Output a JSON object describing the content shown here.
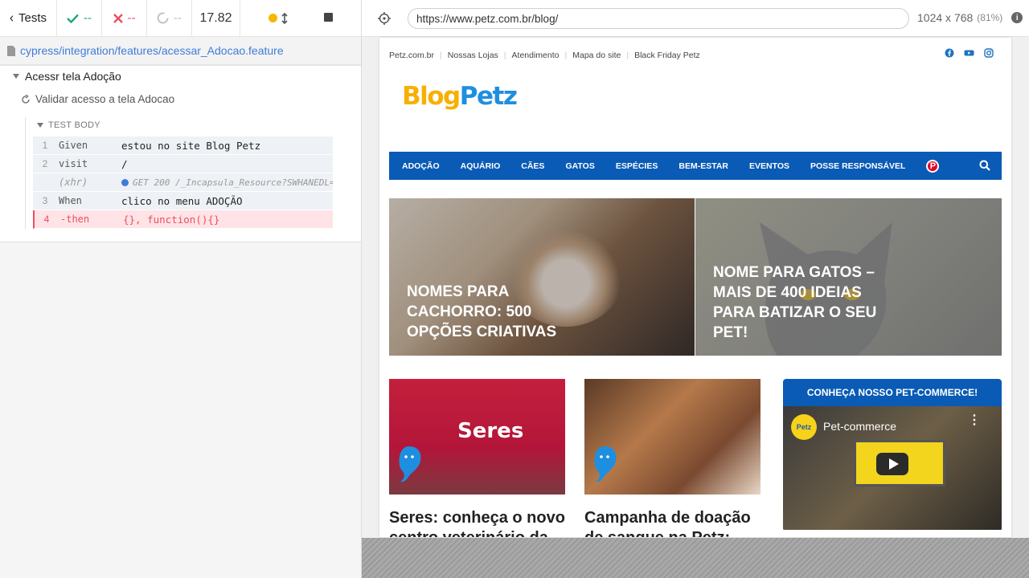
{
  "reporter": {
    "back_label": "Tests",
    "passed": "--",
    "failed": "--",
    "pending": "--",
    "duration": "17.82"
  },
  "spec": {
    "path": "cypress/integration/features/acessar_Adocao.feature"
  },
  "suite": {
    "title": "Acessr tela Adoção"
  },
  "test": {
    "title": "Validar acesso a tela Adocao",
    "body_label": "TEST BODY"
  },
  "commands": [
    {
      "num": "1",
      "name": "Given",
      "message": "estou no site Blog Petz"
    },
    {
      "num": "2",
      "name": "visit",
      "message": "/"
    },
    {
      "num": "",
      "name": "(xhr)",
      "message": "GET 200 /_Incapsula_Resource?SWHANEDL=…"
    },
    {
      "num": "3",
      "name": "When",
      "message": "clico no menu ADOÇÃO"
    },
    {
      "num": "4",
      "name": "-then",
      "message": "{}, function(){}"
    }
  ],
  "aut": {
    "url": "https://www.petz.com.br/blog/",
    "viewport": "1024 x 768",
    "scale": "(81%)"
  },
  "site": {
    "topnav": [
      "Petz.com.br",
      "Nossas Lojas",
      "Atendimento",
      "Mapa do site",
      "Black Friday Petz"
    ],
    "logo_part1": "Blog",
    "logo_part2": "Petz",
    "mainnav": [
      "ADOÇÃO",
      "AQUÁRIO",
      "CÃES",
      "GATOS",
      "ESPÉCIES",
      "BEM-ESTAR",
      "EVENTOS",
      "POSSE RESPONSÁVEL"
    ],
    "hero_left_title": "NOMES PARA CACHORRO: 500 OPÇÕES CRIATIVAS",
    "hero_right_title": "NOME PARA GATOS – MAIS DE 400 IDEIAS PARA BATIZAR O SEU PET!",
    "card_a_title": "Seres: conheça o novo centro veterinário da",
    "card_a_img_text": "Seres",
    "card_b_title": "Campanha de doação de sangue na Petz:",
    "sidebar_title": "CONHEÇA NOSSO PET-COMMERCE!",
    "video_title": "Pet-commerce",
    "video_logo": "Petz"
  }
}
